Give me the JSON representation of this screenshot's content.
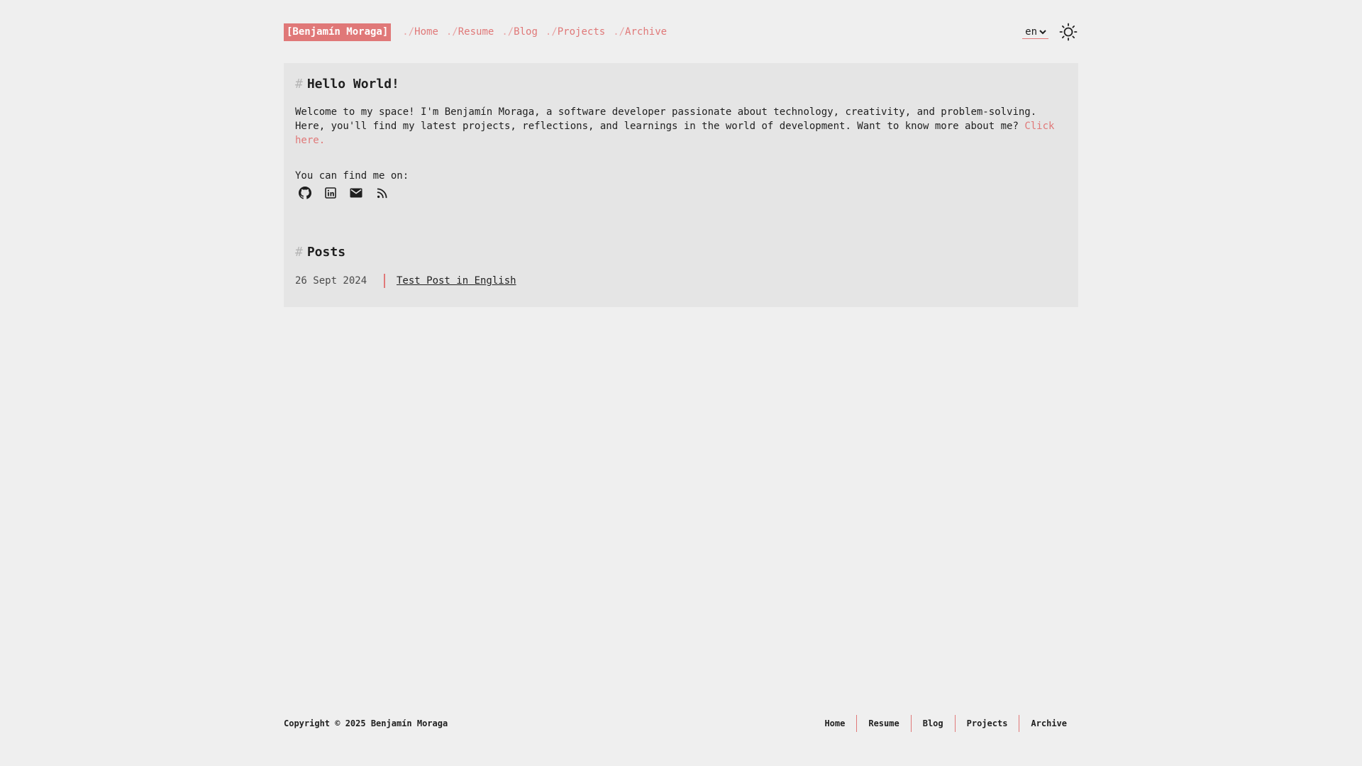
{
  "header": {
    "brand": "[Benjamín Moraga]",
    "nav": [
      {
        "prefix": "./",
        "label": "Home"
      },
      {
        "prefix": "./",
        "label": "Resume"
      },
      {
        "prefix": "./",
        "label": "Blog"
      },
      {
        "prefix": "./",
        "label": "Projects"
      },
      {
        "prefix": "./",
        "label": "Archive"
      }
    ],
    "language": "en",
    "theme_icon": "sun-icon"
  },
  "intro": {
    "hash": "#",
    "title": "Hello World!",
    "text": "Welcome to my space! I'm Benjamín Moraga, a software developer passionate about technology, creativity, and problem-solving. Here, you'll find my latest projects, reflections, and learnings in the world of development. Want to know more about me? ",
    "link_text": "Click here.",
    "find_me": "You can find me on:",
    "socials": [
      "github-icon",
      "linkedin-icon",
      "mail-icon",
      "rss-icon"
    ]
  },
  "posts": {
    "hash": "#",
    "title": "Posts",
    "items": [
      {
        "date": "26 Sept 2024",
        "title": "Test Post in English"
      }
    ]
  },
  "footer": {
    "copyright": "Copyright © 2025 Benjamín Moraga",
    "links": [
      "Home",
      "Resume",
      "Blog",
      "Projects",
      "Archive"
    ]
  },
  "colors": {
    "accent": "#e07878",
    "background": "#efefef",
    "card": "#e5e5e5",
    "text": "#1f1f1f"
  }
}
